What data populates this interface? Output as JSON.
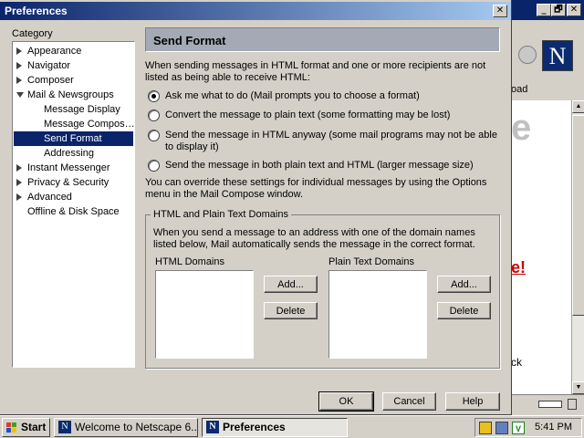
{
  "dialog": {
    "title": "Preferences",
    "close_glyph": "✕",
    "category_label": "Category",
    "tree": [
      {
        "label": "Appearance",
        "level": 0,
        "twisty": "closed"
      },
      {
        "label": "Navigator",
        "level": 0,
        "twisty": "closed"
      },
      {
        "label": "Composer",
        "level": 0,
        "twisty": "closed"
      },
      {
        "label": "Mail & Newsgroups",
        "level": 0,
        "twisty": "open"
      },
      {
        "label": "Message Display",
        "level": 1
      },
      {
        "label": "Message Compos…",
        "level": 1
      },
      {
        "label": "Send Format",
        "level": 1,
        "selected": true
      },
      {
        "label": "Addressing",
        "level": 1
      },
      {
        "label": "Instant Messenger",
        "level": 0,
        "twisty": "closed"
      },
      {
        "label": "Privacy & Security",
        "level": 0,
        "twisty": "closed"
      },
      {
        "label": "Advanced",
        "level": 0,
        "twisty": "closed"
      },
      {
        "label": "Offline & Disk Space",
        "level": 0,
        "twisty": "none"
      }
    ],
    "panel": {
      "header": "Send Format",
      "intro": "When sending messages in HTML format and one or more recipients are not listed as being able to receive HTML:",
      "options": [
        {
          "label": "Ask me what to do (Mail prompts you to choose a format)",
          "checked": true
        },
        {
          "label": "Convert the message to plain text (some formatting may be lost)",
          "checked": false
        },
        {
          "label": "Send the message in HTML anyway (some mail programs may not be able to display it)",
          "checked": false
        },
        {
          "label": "Send the message in both plain text and HTML (larger message size)",
          "checked": false
        }
      ],
      "override_note": "You can override these settings for individual messages by using the Options menu in the Mail Compose window.",
      "domains": {
        "group_title": "HTML and Plain Text Domains",
        "description": "When you send a message to an address with one of the domain names listed below, Mail automatically sends the message in the correct format.",
        "html_label": "HTML Domains",
        "plain_label": "Plain Text Domains",
        "html_items": [],
        "plain_items": [],
        "add_label": "Add...",
        "delete_label": "Delete"
      }
    },
    "buttons": {
      "ok": "OK",
      "cancel": "Cancel",
      "help": "Help"
    }
  },
  "background_window": {
    "tab_text": "oad",
    "big_glyph": "e",
    "red_text": "e!",
    "small_text": "ck",
    "logo_letter": "N",
    "controls": [
      "_",
      "🗗",
      "✕"
    ]
  },
  "taskbar": {
    "start_label": "Start",
    "tasks": [
      {
        "label": "Welcome to Netscape 6....",
        "active": false
      },
      {
        "label": "Preferences",
        "active": true
      }
    ],
    "clock": "5:41 PM"
  },
  "colors": {
    "titlebar_start": "#0a246a",
    "titlebar_end": "#a6caf0",
    "selection": "#0a246a",
    "header_box": "#a3aab5",
    "face": "#d4d0c8"
  }
}
